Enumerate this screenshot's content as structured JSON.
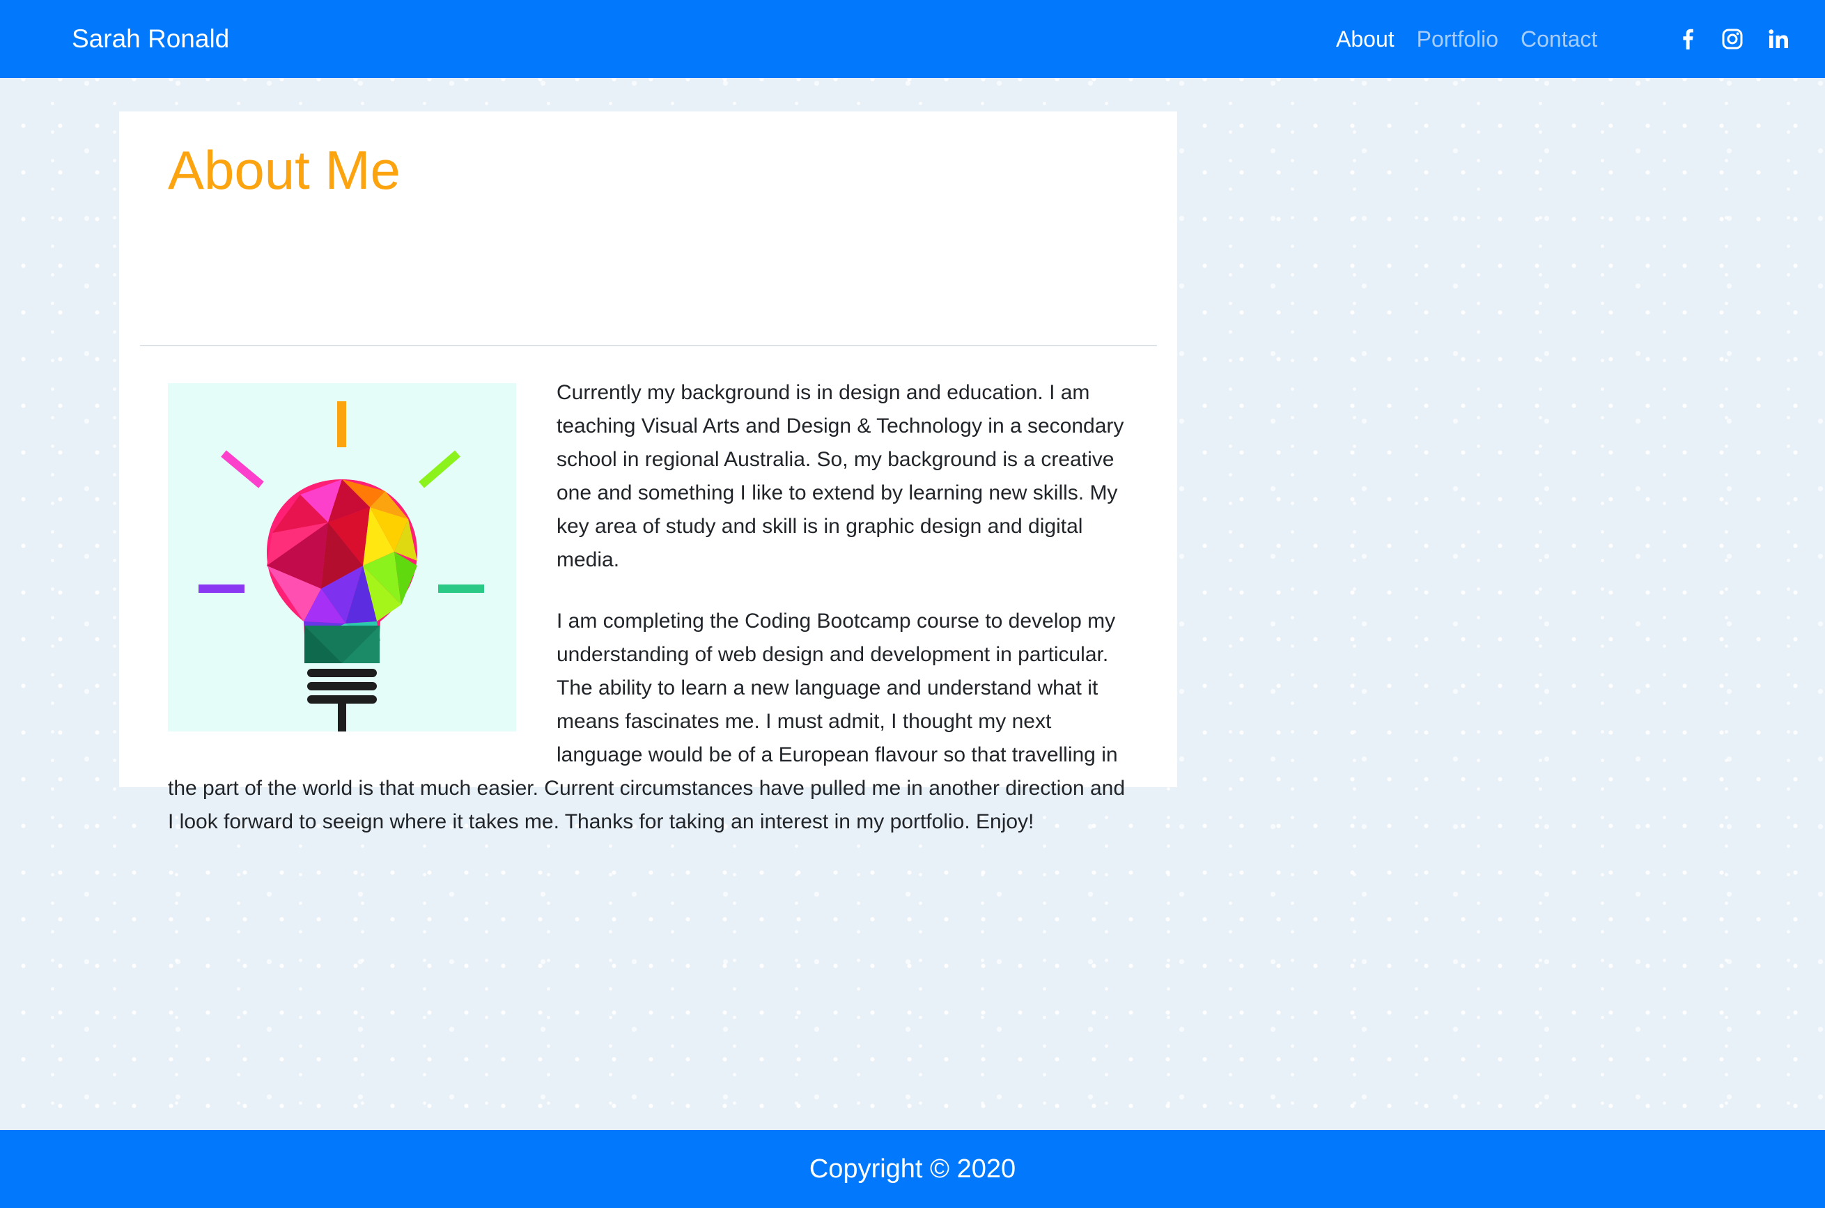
{
  "navbar": {
    "brand": "Sarah Ronald",
    "links": [
      {
        "label": "About",
        "active": true
      },
      {
        "label": "Portfolio",
        "active": false
      },
      {
        "label": "Contact",
        "active": false
      }
    ],
    "social_icons": [
      "facebook-icon",
      "instagram-icon",
      "linkedin-icon"
    ]
  },
  "about": {
    "title": "About Me",
    "image_icon": "lightbulb-icon",
    "paragraphs": [
      "Currently my background is in design and education. I am teaching Visual Arts and Design & Technology in a secondary school in regional Australia. So, my background is a creative one and something I like to extend by learning new skills. My key area of study and skill is in graphic design and digital media.",
      "I am completing the Coding Bootcamp course to develop my understanding of web design and development in particular. The ability to learn a new language and understand what it means fascinates me. I must admit, I thought my next language would be of a European flavour so that travelling in the part of the world is that much easier. Current circumstances have pulled me in another direction and I look forward to seeign where it takes me. Thanks for taking an interest in my portfolio. Enjoy!"
    ]
  },
  "footer": {
    "copyright": "Copyright © 2020"
  },
  "colors": {
    "primary": "#0279fd",
    "title_accent": "#fca310",
    "inactive_link": "#a7cdfd",
    "page_background": "#e9f1f8",
    "image_background": "#e5fdf9"
  }
}
